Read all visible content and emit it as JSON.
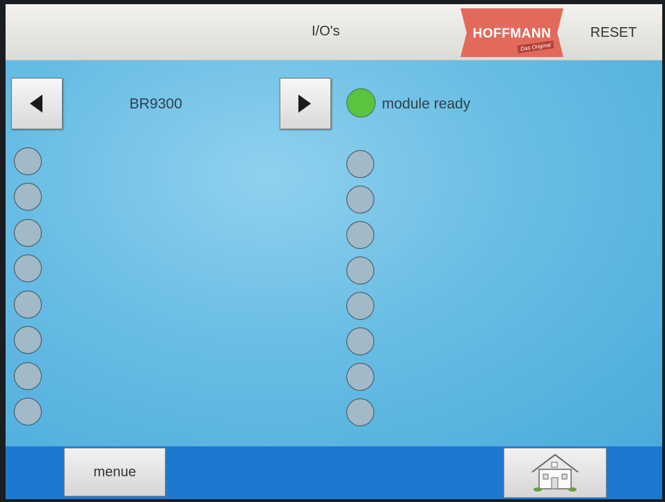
{
  "header": {
    "title": "I/O's",
    "logo_text": "HOFFMANN",
    "logo_tagline": "Das Original",
    "reset_label": "RESET"
  },
  "module": {
    "name": "BR9300",
    "status_label": "module ready",
    "status_color": "#58c440",
    "prev_icon": "triangle-left-icon",
    "next_icon": "triangle-right-icon"
  },
  "io_columns": {
    "inputs_count": 8,
    "outputs_count": 8,
    "led_off_color": "#a2b9c8"
  },
  "footer": {
    "menue_label": "menue",
    "home_icon": "home-icon"
  }
}
